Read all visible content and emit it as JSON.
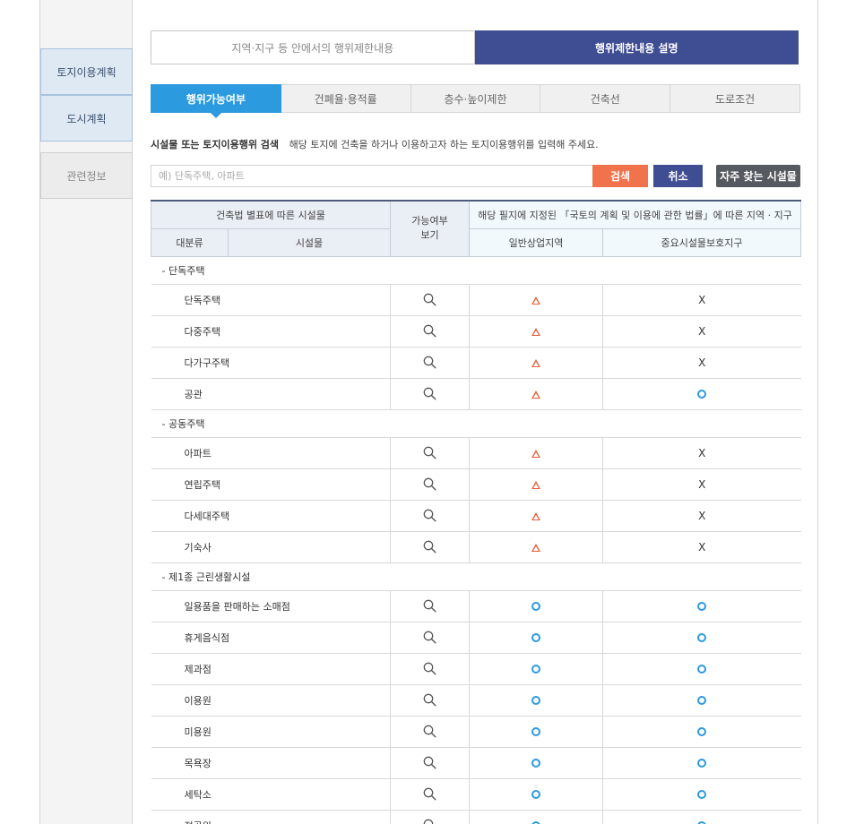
{
  "sidebar": {
    "items": [
      {
        "label": "토지이용계획"
      },
      {
        "label": "도시계획"
      },
      {
        "label": "관련정보"
      }
    ]
  },
  "top_tabs": [
    {
      "label": "지역·지구 등 안에서의 행위제한내용"
    },
    {
      "label": "행위제한내용 설명"
    }
  ],
  "sub_tabs": [
    {
      "label": "행위가능여부"
    },
    {
      "label": "건폐율·용적률"
    },
    {
      "label": "층수·높이제한"
    },
    {
      "label": "건축선"
    },
    {
      "label": "도로조건"
    }
  ],
  "search": {
    "title": "시설물 또는 토지이용행위 검색",
    "description": "해당 토지에 건축을 하거나 이용하고자 하는 토지이용행위를 입력해 주세요.",
    "placeholder": "예) 단독주택, 아파트",
    "search_label": "검색",
    "cancel_label": "취소",
    "frequent_label": "자주 찾는 시설물"
  },
  "table": {
    "header_buildings": "건축법 별표에 따른 시설물",
    "header_possible": "가능여부\n보기",
    "header_zones": "해당 필지에 지정된 「국토의 계획 및 이용에 관한 법률」에 따른 지역 · 지구",
    "col_category": "대분류",
    "col_facility": "시설물",
    "zones": [
      "일반상업지역",
      "중요시설물보호지구"
    ],
    "legend": {
      "triangle": "△",
      "circle": "○",
      "x": "X"
    },
    "groups": [
      {
        "label": "- 단독주택",
        "rows": [
          {
            "name": "단독주택",
            "z1": "triangle",
            "z2": "x"
          },
          {
            "name": "다중주택",
            "z1": "triangle",
            "z2": "x"
          },
          {
            "name": "다가구주택",
            "z1": "triangle",
            "z2": "x"
          },
          {
            "name": "공관",
            "z1": "triangle",
            "z2": "circle"
          }
        ]
      },
      {
        "label": "- 공동주택",
        "rows": [
          {
            "name": "아파트",
            "z1": "triangle",
            "z2": "x"
          },
          {
            "name": "연립주택",
            "z1": "triangle",
            "z2": "x"
          },
          {
            "name": "다세대주택",
            "z1": "triangle",
            "z2": "x"
          },
          {
            "name": "기숙사",
            "z1": "triangle",
            "z2": "x"
          }
        ]
      },
      {
        "label": "- 제1종 근린생활시설",
        "rows": [
          {
            "name": "일용품을 판매하는 소매점",
            "z1": "circle",
            "z2": "circle"
          },
          {
            "name": "휴게음식점",
            "z1": "circle",
            "z2": "circle"
          },
          {
            "name": "제과점",
            "z1": "circle",
            "z2": "circle"
          },
          {
            "name": "이용원",
            "z1": "circle",
            "z2": "circle"
          },
          {
            "name": "미용원",
            "z1": "circle",
            "z2": "circle"
          },
          {
            "name": "목욕장",
            "z1": "circle",
            "z2": "circle"
          },
          {
            "name": "세탁소",
            "z1": "circle",
            "z2": "circle"
          },
          {
            "name": "정골원",
            "z1": "circle",
            "z2": "circle"
          }
        ]
      }
    ]
  },
  "colors": {
    "accent_blue": "#2b9adf",
    "navy": "#3f4d93",
    "orange": "#f0734b",
    "triangle": "#e8603c"
  }
}
